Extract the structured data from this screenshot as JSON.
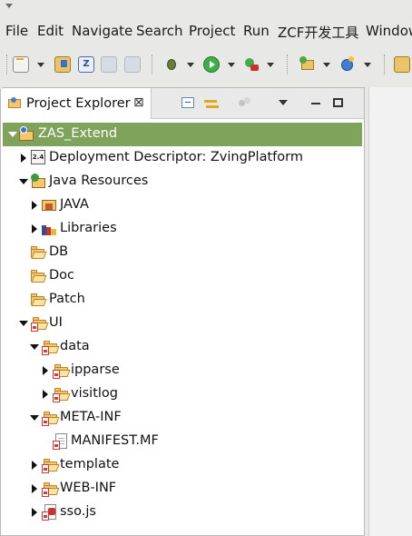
{
  "menu": {
    "items": [
      {
        "label": "File"
      },
      {
        "label": "Edit"
      },
      {
        "label": "Navigate"
      },
      {
        "label": "Search"
      },
      {
        "label": "Project"
      },
      {
        "label": "Run"
      },
      {
        "label": "ZCF开发工具"
      },
      {
        "label": "Window"
      }
    ]
  },
  "toolbar": {
    "icons": [
      "new-icon",
      "open-type-icon",
      "zving-icon",
      "save-icon",
      "save-all-icon",
      "debug-icon",
      "run-icon",
      "external-tools-icon",
      "new-java-project-icon",
      "new-class-icon",
      "open-perspective-icon"
    ]
  },
  "panel": {
    "tab_title": "Project Explorer",
    "tab_close": "⊠"
  },
  "tree": {
    "rows": [
      {
        "label": "ZAS_Extend",
        "icon": "project-icon",
        "expanded": true,
        "selected": true
      },
      {
        "label": "Deployment Descriptor: ZvingPlatform",
        "icon": "deployment-descriptor-icon",
        "expanded": false
      },
      {
        "label": "Java Resources",
        "icon": "java-resources-icon",
        "expanded": true
      },
      {
        "label": "JAVA",
        "icon": "source-folder-icon",
        "expanded": false
      },
      {
        "label": "Libraries",
        "icon": "libraries-icon",
        "expanded": false
      },
      {
        "label": "DB",
        "icon": "folder-icon"
      },
      {
        "label": "Doc",
        "icon": "folder-icon"
      },
      {
        "label": "Patch",
        "icon": "folder-icon"
      },
      {
        "label": "UI",
        "icon": "ui-folder-icon",
        "expanded": true
      },
      {
        "label": "data",
        "icon": "folder-icon",
        "expanded": true
      },
      {
        "label": "ipparse",
        "icon": "folder-icon",
        "expanded": false
      },
      {
        "label": "visitlog",
        "icon": "folder-icon",
        "expanded": false
      },
      {
        "label": "META-INF",
        "icon": "folder-icon",
        "expanded": true
      },
      {
        "label": "MANIFEST.MF",
        "icon": "file-icon"
      },
      {
        "label": "template",
        "icon": "folder-icon",
        "expanded": false
      },
      {
        "label": "WEB-INF",
        "icon": "folder-icon",
        "expanded": false
      },
      {
        "label": "sso.js",
        "icon": "js-file-icon",
        "expanded": false
      }
    ]
  }
}
